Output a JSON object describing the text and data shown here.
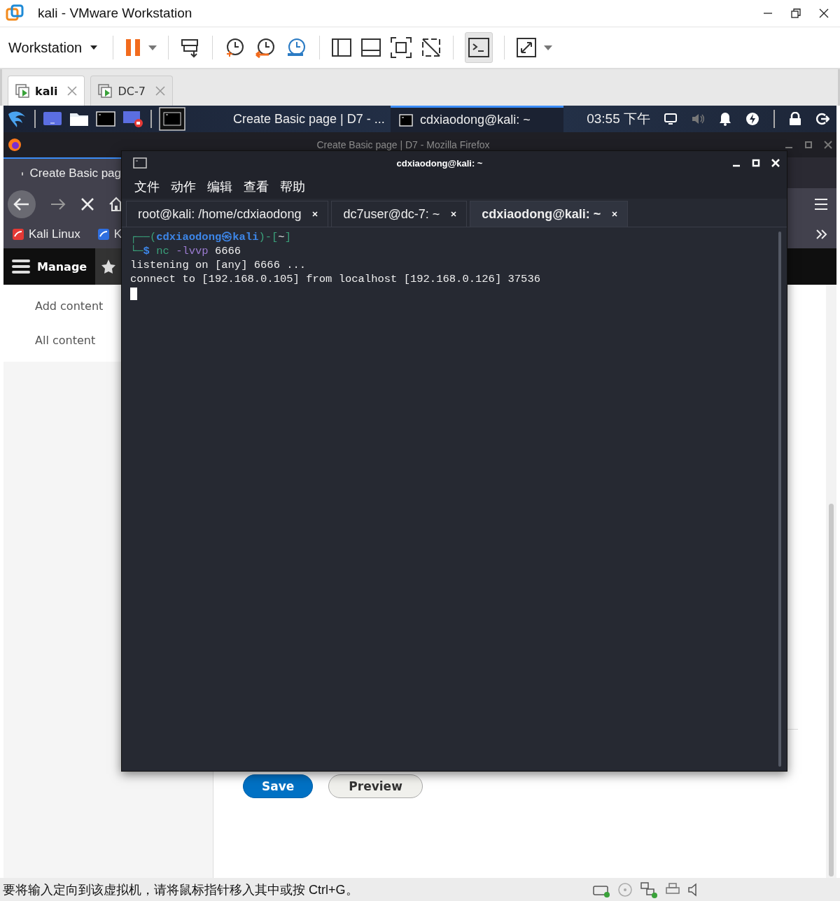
{
  "window": {
    "title": "kali - VMware Workstation"
  },
  "toolbar": {
    "menu": "Workstation"
  },
  "vm_tabs": [
    {
      "label": "kali",
      "selected": true
    },
    {
      "label": "DC-7",
      "selected": false
    }
  ],
  "guest_panel": {
    "tasks": [
      {
        "label": "Create Basic page | D7 - ...",
        "selected": false
      },
      {
        "label": "cdxiaodong@kali: ~",
        "selected": true
      }
    ],
    "clock": "03:55 下午"
  },
  "browser": {
    "title": "Create Basic page | D7 - Mozilla Firefox",
    "tab": "Create Basic pag",
    "bookmarks": [
      "Kali Linux",
      "K"
    ]
  },
  "drupal": {
    "manage": "Manage",
    "menu": [
      "Add content",
      "All content"
    ]
  },
  "form": {
    "buttons": [
      {
        "label": "Save",
        "kind": "primary"
      },
      {
        "label": "Preview",
        "kind": "secondary"
      }
    ]
  },
  "terminal": {
    "title": "cdxiaodong@kali: ~",
    "menu": [
      "文件",
      "动作",
      "编辑",
      "查看",
      "帮助"
    ],
    "tabs": [
      {
        "label": "root@kali: /home/cdxiaodong",
        "selected": false
      },
      {
        "label": "dc7user@dc-7: ~",
        "selected": false
      },
      {
        "label": "cdxiaodong@kali: ~",
        "selected": true
      }
    ],
    "lines": [
      [
        {
          "text": "┌──(",
          "kind": "frame"
        },
        {
          "text": "cdxiaodong㉿kali",
          "kind": "user"
        },
        {
          "text": ")-[",
          "kind": "frame"
        },
        {
          "text": "~",
          "kind": "plain"
        },
        {
          "text": "]",
          "kind": "frame"
        }
      ],
      [
        {
          "text": "└─",
          "kind": "frame"
        },
        {
          "text": "$ ",
          "kind": "user"
        },
        {
          "text": "nc ",
          "kind": "cmd"
        },
        {
          "text": "-lvvp ",
          "kind": "opt"
        },
        {
          "text": "6666",
          "kind": "plain"
        }
      ],
      [
        {
          "text": "listening on [any] 6666 ...",
          "kind": "plain"
        }
      ],
      [
        {
          "text": "connect to [192.168.0.105] from localhost [192.168.0.126] 37536",
          "kind": "plain"
        }
      ]
    ]
  },
  "status_bar": {
    "message": "要将输入定向到该虚拟机，请将鼠标指针移入其中或按 Ctrl+G。"
  }
}
